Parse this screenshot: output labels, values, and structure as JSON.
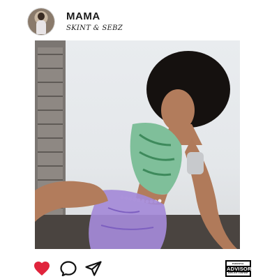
{
  "post": {
    "title": "MAMA",
    "subtitle": "SKINT & SEBZ"
  },
  "icons": {
    "like": "heart-icon",
    "comment": "comment-icon",
    "share": "send-icon"
  },
  "colors": {
    "like_active": "#e0243c",
    "icon_stroke": "#111111",
    "background": "#ffffff"
  },
  "advisory": {
    "line1": "PARENTAL",
    "line2": "ADVISORY",
    "line3": "EXPLICIT CONTENT"
  }
}
